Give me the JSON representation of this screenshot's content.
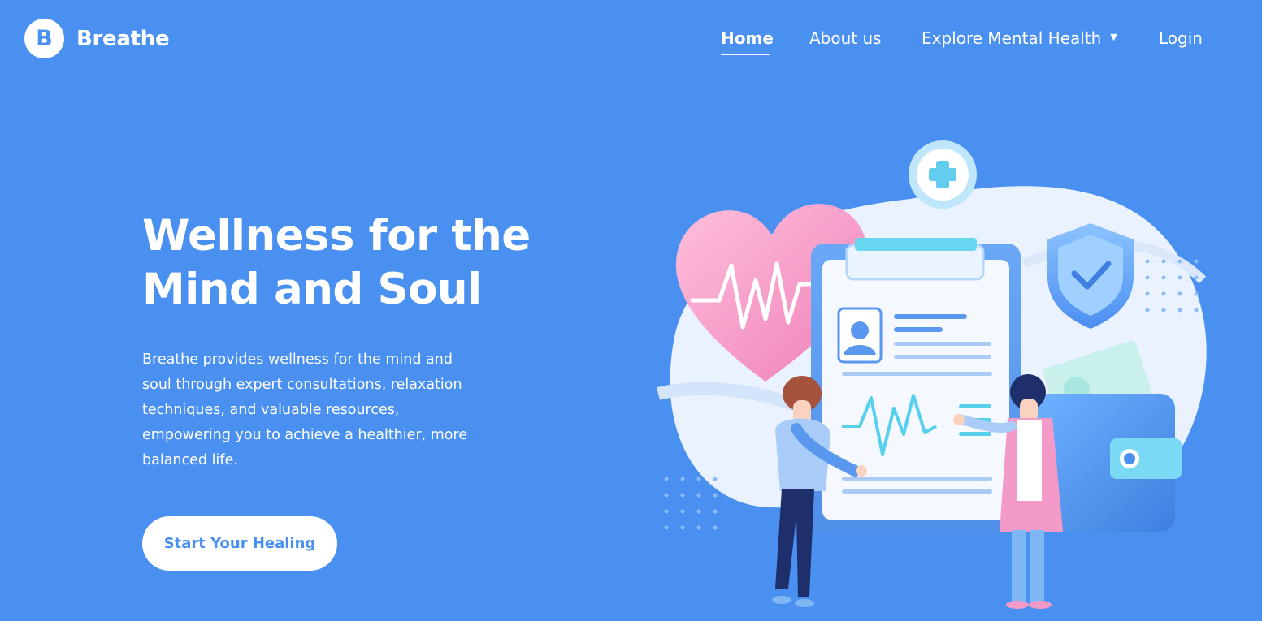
{
  "brand": {
    "logo_letter": "B",
    "name": "Breathe"
  },
  "nav": {
    "home": "Home",
    "about": "About us",
    "explore": "Explore Mental Health",
    "login": "Login"
  },
  "hero": {
    "title_line1": "Wellness for the",
    "title_line2": "Mind and Soul",
    "description": "Breathe provides wellness for the mind and soul through expert consultations, relaxation techniques, and valuable resources, empowering you to achieve a healthier, more balanced life.",
    "cta_label": "Start Your Healing"
  },
  "colors": {
    "background": "#4a90f0",
    "accent_pink": "#f48cc4",
    "accent_cyan": "#5fd6ec"
  }
}
